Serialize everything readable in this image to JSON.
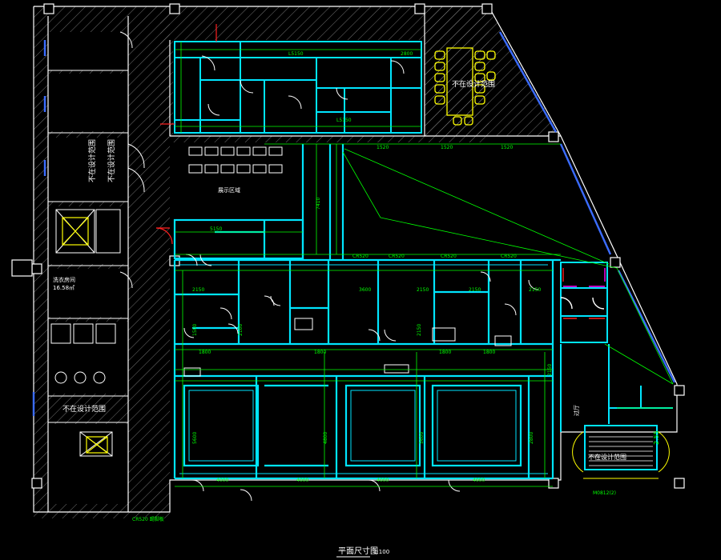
{
  "drawing": {
    "title": "平面尺寸图",
    "scale": "1:100",
    "colors": {
      "background": "#000000",
      "wall": "#00e5ff",
      "dimension": "#00ff00",
      "hatch": "#9a9a9a",
      "furniture": "#ffffff",
      "accent_red": "#ff2020",
      "accent_magenta": "#ff00ff",
      "accent_yellow": "#ffff00",
      "accent_blue": "#3b6cff"
    }
  },
  "labels": {
    "conference_room": "不在设计范围",
    "left_room": "不在设计范围",
    "elevator_room": "不在设计范围",
    "stair_room": "不在设计范围",
    "area_label": "洗衣房间",
    "area_value": "16.58㎡",
    "hall": "展示区域",
    "corridor": "过厅",
    "bottom_note": "CR520 踢脚板",
    "right_note": "M0812(2)",
    "stair_dim": "2.55"
  },
  "dimensions": {
    "top_row": [
      "1630",
      "5150",
      "2800",
      "3720"
    ],
    "mid_row": [
      "CR520",
      "CR520",
      "CR520",
      "CR520"
    ],
    "upper_row": [
      "1520",
      "1520",
      "1520"
    ],
    "lab_row": [
      "5150",
      "2150",
      "3600",
      "2150",
      "2150",
      "2150"
    ],
    "lab_bottom": [
      "1800",
      "1800",
      "1800",
      "1800"
    ],
    "bay_widths": [
      "4000",
      "4000",
      "4000",
      "4000"
    ],
    "vertical_left": [
      "5600",
      "1500",
      "2100"
    ],
    "vertical_right": [
      "4800",
      "2150",
      "2800"
    ],
    "mid_vertical": "7410",
    "stair_span": "2150",
    "bay_depth": "5600"
  }
}
